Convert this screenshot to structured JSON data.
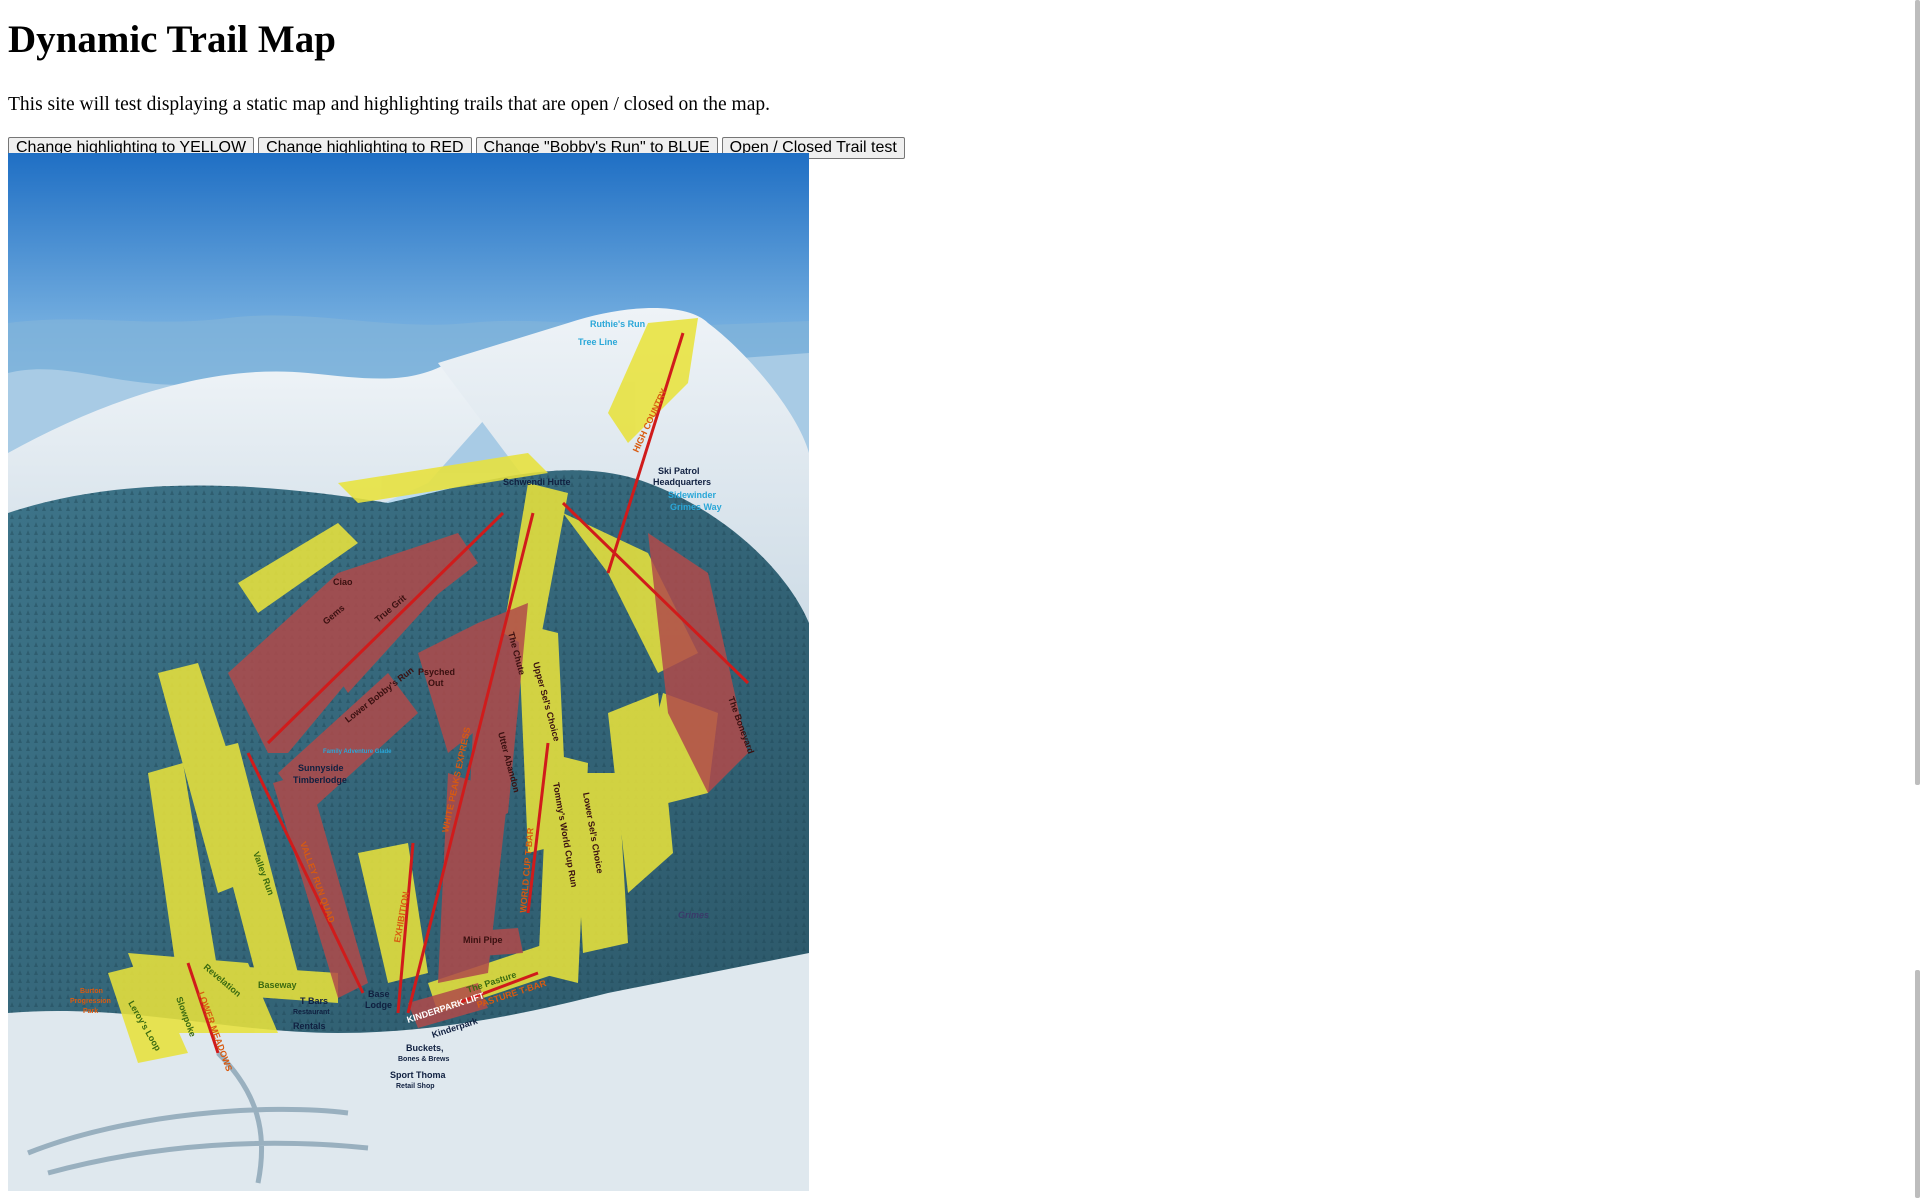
{
  "page": {
    "title": "Dynamic Trail Map",
    "intro": "This site will test displaying a static map and highlighting trails that are open / closed on the map."
  },
  "buttons": [
    {
      "label": "Change highlighting to YELLOW"
    },
    {
      "label": "Change highlighting to RED"
    },
    {
      "label": "Change \"Bobby's Run\" to BLUE"
    },
    {
      "label": "Open / Closed Trail test"
    }
  ],
  "colors": {
    "open_trail": "#e8e23c",
    "closed_trail": "#b04a4a",
    "lift": "#d01b1b",
    "sky_top": "#1f6fc4",
    "sky_bottom": "#cfe6f5",
    "forest": "#2f5f73",
    "snow": "#e9eef2",
    "glade_label": "#2aa7d8"
  },
  "map": {
    "labels": {
      "ruthies_run": "Ruthie's Run",
      "tree_line": "Tree Line",
      "schwendi_hutte": "Schwendi Hutte",
      "ski_patrol": "Ski Patrol",
      "headquarters": "Headquarters",
      "sidewinder": "Sidewinder",
      "grimes_way": "Grimes Way",
      "high_country": "HIGH COUNTRY",
      "ciao": "Ciao",
      "gems": "Gems",
      "true_grit": "True Grit",
      "lower_bobbys_run": "Lower Bobby's Run",
      "psyched_out": "Psyched",
      "psyched_out2": "Out",
      "the_chute": "The Chute",
      "upper_sels_choice": "Upper Sel's Choice",
      "the_boneyard": "The Boneyard",
      "sunnyside": "Sunnyside",
      "timberlodge": "Timberlodge",
      "family_glade": "Family Adventure Glade",
      "valley_run": "Valley Run",
      "valley_run_quad": "VALLEY RUN QUAD",
      "white_peaks_express": "WHITE PEAKS EXPRESS",
      "exhibition": "EXHIBITION",
      "utter_abandon": "Utter Abandon",
      "tommys_world_cup": "Tommy's World Cup Run",
      "lower_sels_choice": "Lower Sel's Choice",
      "world_cup_tbar": "WORLD CUP T-BAR",
      "mini_pipe": "Mini Pipe",
      "the_pasture": "The Pasture",
      "pasture_tbar": "PASTURE T-BAR",
      "kinderpark_lift": "KINDERPARK LIFT",
      "kinderpark": "Kinderpark",
      "baseway": "Baseway",
      "revelation": "Revelation",
      "lower_meadows": "LOWER MEADOWS",
      "slowpoke": "Slowpoke",
      "leroys_loop": "Leroy's Loop",
      "burton": "Burton",
      "progression": "Progression",
      "park": "Park",
      "t_bars": "T Bars",
      "restaurant": "Restaurant",
      "rentals": "Rentals",
      "base": "Base",
      "lodge": "Lodge",
      "buckets": "Buckets,",
      "bones_brews": "Bones & Brews",
      "sport_thoma": "Sport Thoma",
      "retail_shop": "Retail Shop",
      "signature": "Grimes"
    }
  }
}
